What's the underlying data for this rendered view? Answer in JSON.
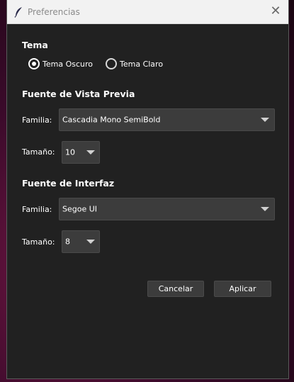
{
  "window": {
    "title": "Preferencias"
  },
  "icons": {
    "app": "feather-icon",
    "close": "close-icon"
  },
  "tema": {
    "heading": "Tema",
    "options": [
      {
        "label": "Tema Oscuro",
        "selected": true
      },
      {
        "label": "Tema Claro",
        "selected": false
      }
    ]
  },
  "preview_font": {
    "heading": "Fuente de Vista Previa",
    "family_label": "Familia:",
    "family_value": "Cascadia Mono SemiBold",
    "size_label": "Tamaño:",
    "size_value": "10"
  },
  "ui_font": {
    "heading": "Fuente de Interfaz",
    "family_label": "Familia:",
    "family_value": "Segoe UI",
    "size_label": "Tamaño:",
    "size_value": "8"
  },
  "buttons": {
    "cancel": "Cancelar",
    "apply": "Aplicar"
  }
}
